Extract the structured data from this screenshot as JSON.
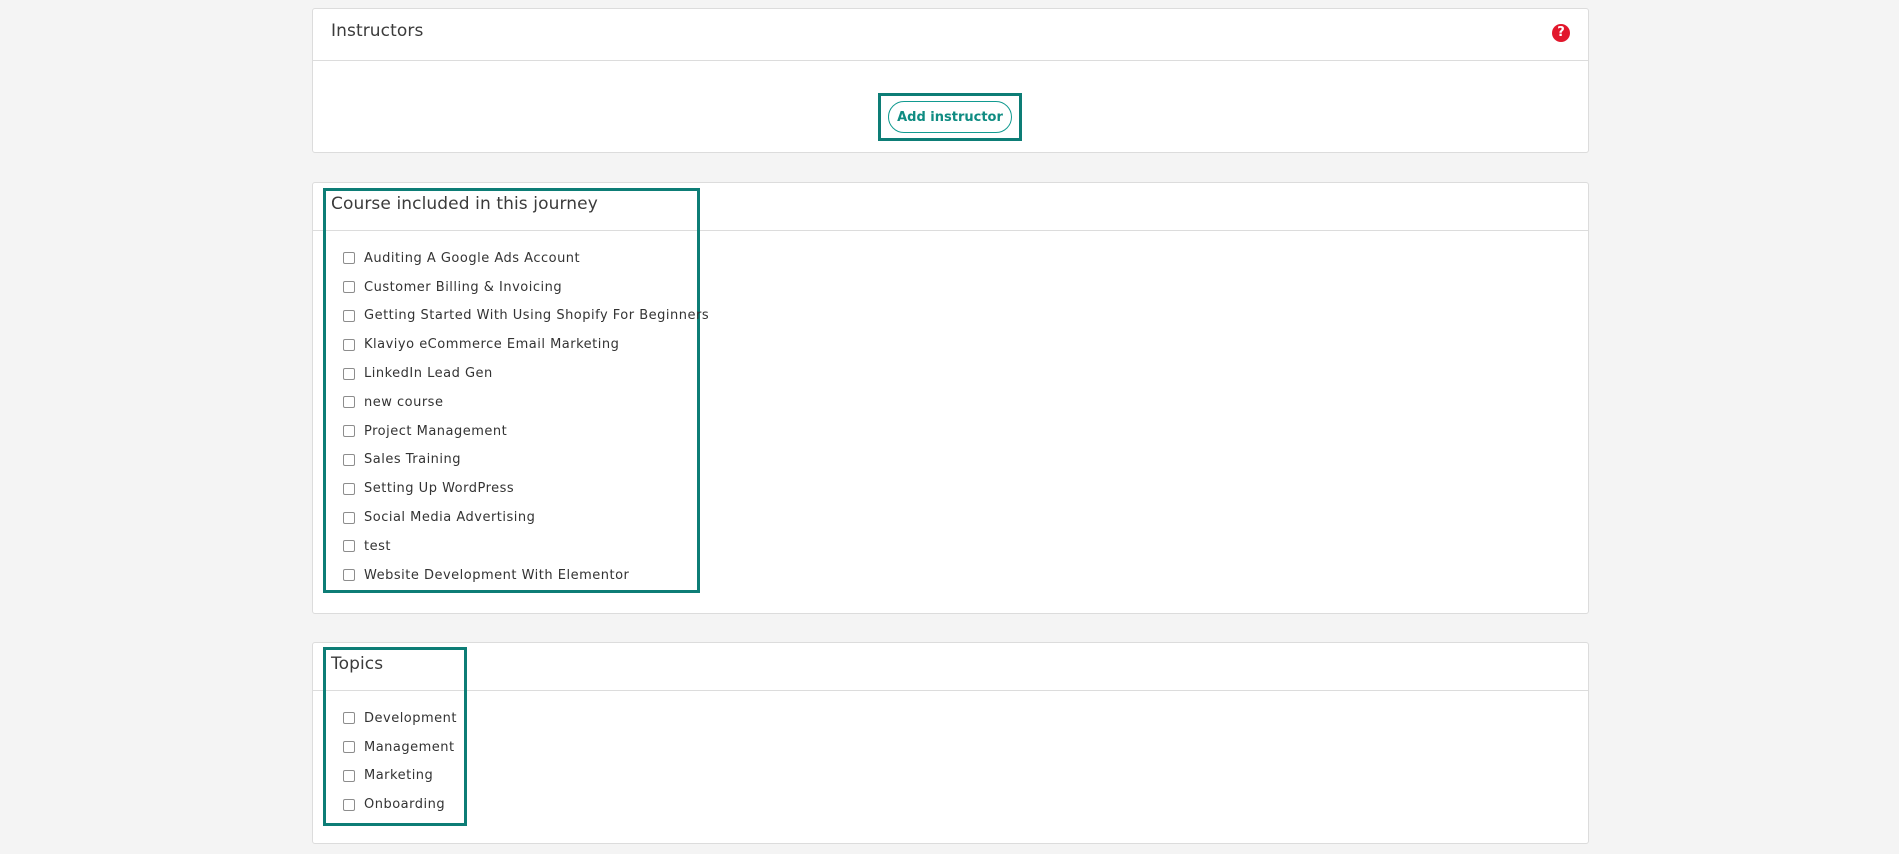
{
  "instructors_panel": {
    "title": "Instructors",
    "help_icon": "question-circle-icon",
    "add_button_label": "Add instructor"
  },
  "courses_panel": {
    "title": "Course included in this journey",
    "items": [
      {
        "label": "Auditing A Google Ads Account",
        "checked": false
      },
      {
        "label": "Customer Billing & Invoicing",
        "checked": false
      },
      {
        "label": "Getting Started With Using Shopify For Beginners",
        "checked": false
      },
      {
        "label": "Klaviyo eCommerce Email Marketing",
        "checked": false
      },
      {
        "label": "LinkedIn Lead Gen",
        "checked": false
      },
      {
        "label": "new course",
        "checked": false
      },
      {
        "label": "Project Management",
        "checked": false
      },
      {
        "label": "Sales Training",
        "checked": false
      },
      {
        "label": "Setting Up WordPress",
        "checked": false
      },
      {
        "label": "Social Media Advertising",
        "checked": false
      },
      {
        "label": "test",
        "checked": false
      },
      {
        "label": "Website Development With Elementor",
        "checked": false
      }
    ]
  },
  "topics_panel": {
    "title": "Topics",
    "items": [
      {
        "label": "Development",
        "checked": false
      },
      {
        "label": "Management",
        "checked": false
      },
      {
        "label": "Marketing",
        "checked": false
      },
      {
        "label": "Onboarding",
        "checked": false
      }
    ]
  },
  "colors": {
    "accent": "#0d7d76",
    "help_icon": "#e2172c",
    "background": "#f4f4f4"
  }
}
